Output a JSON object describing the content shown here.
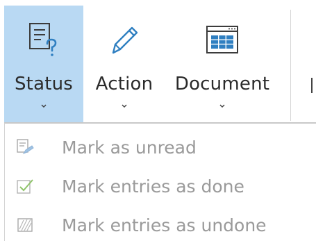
{
  "ribbon": {
    "buttons": [
      {
        "label": "Status",
        "icon": "status-report-icon",
        "selected": true
      },
      {
        "label": "Action",
        "icon": "pencil-icon",
        "selected": false
      },
      {
        "label": "Document",
        "icon": "document-table-icon",
        "selected": false
      }
    ]
  },
  "status_menu": {
    "items": [
      {
        "label": "Mark as unread",
        "icon": "mark-unread-icon",
        "enabled": false
      },
      {
        "label": "Mark entries as done",
        "icon": "checkmark-icon",
        "enabled": false
      },
      {
        "label": "Mark entries as undone",
        "icon": "hatched-box-icon",
        "enabled": false
      }
    ]
  },
  "colors": {
    "selected_background": "#b9d9f3",
    "icon_blue": "#2f7fc1",
    "icon_dark": "#3c3c3c",
    "disabled_text": "#9a9a9a",
    "checkmark_green": "#7fbf5a"
  }
}
